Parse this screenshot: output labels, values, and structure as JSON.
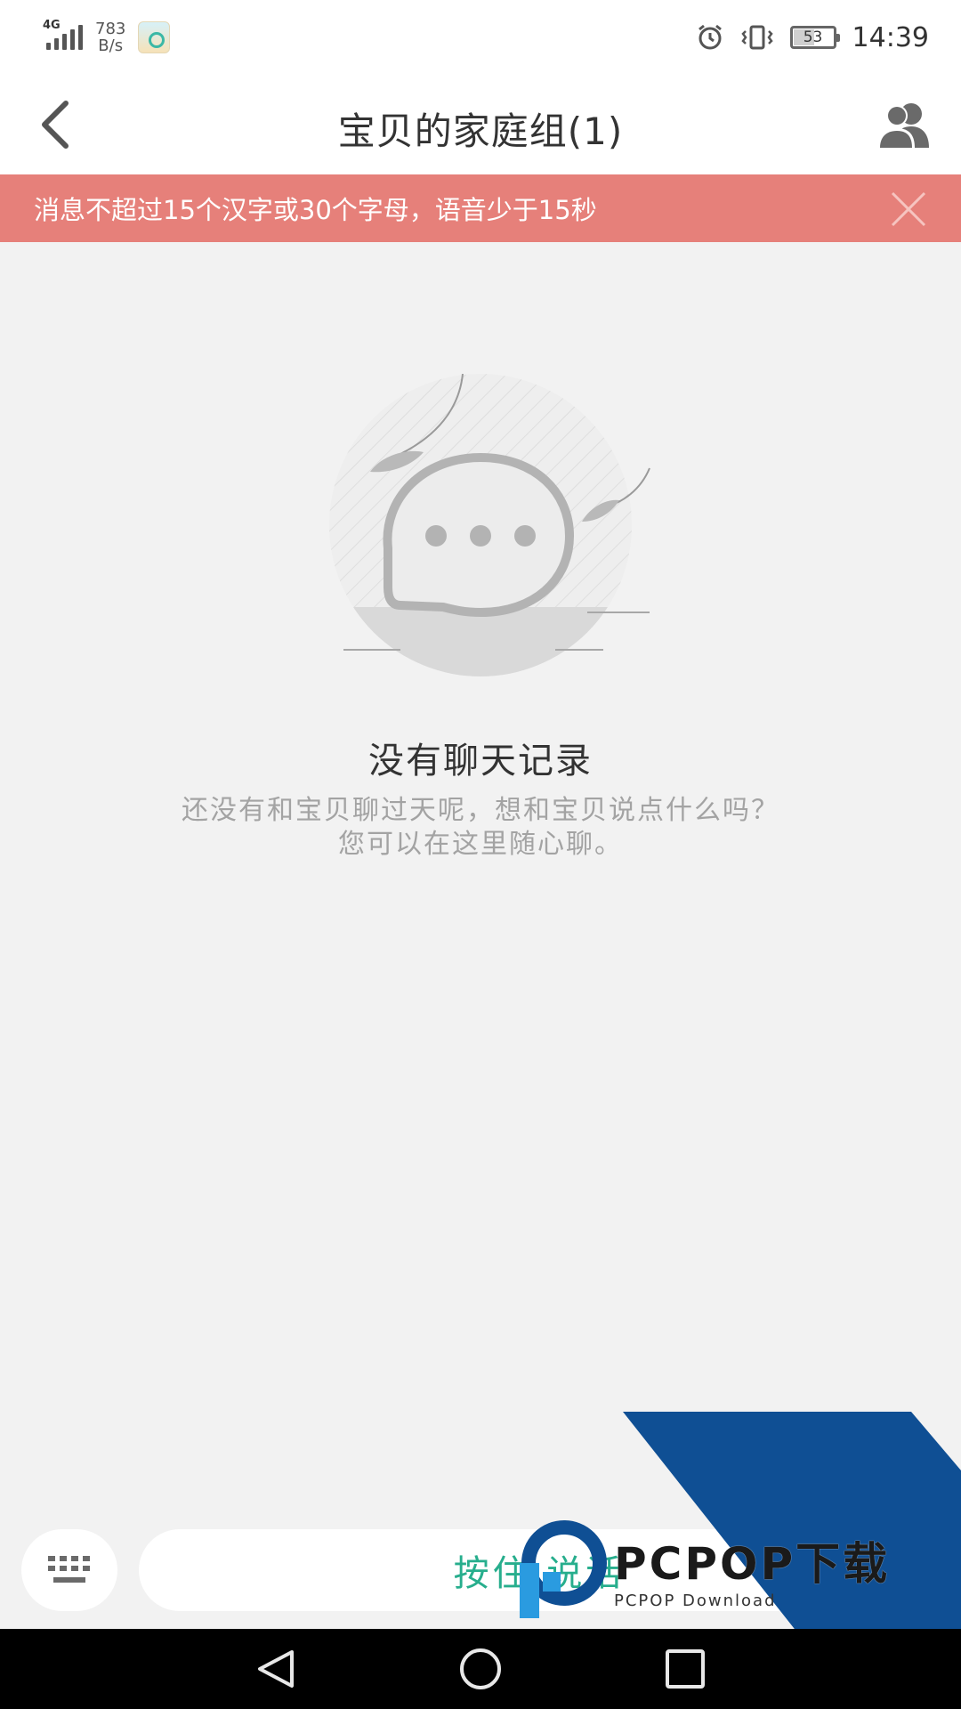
{
  "status_bar": {
    "network_type": "4G",
    "net_speed_value": "783",
    "net_speed_unit": "B/s",
    "time": "14:39",
    "battery_level": "53",
    "alarm_icon": "alarm-icon",
    "vibrate_icon": "vibrate-icon"
  },
  "header": {
    "title": "宝贝的家庭组(1)",
    "back_icon": "chevron-left-icon",
    "members_icon": "group-members-icon"
  },
  "notice": {
    "text": "消息不超过15个汉字或30个字母，语音少于15秒",
    "close_icon": "close-icon"
  },
  "empty_state": {
    "title": "没有聊天记录",
    "line1": "还没有和宝贝聊过天呢，想和宝贝说点什么吗？",
    "line2": "您可以在这里随心聊。"
  },
  "input_bar": {
    "keyboard_icon": "keyboard-icon",
    "hold_to_talk_label": "按住 说话"
  },
  "watermark": {
    "brand": "PCPOP下载",
    "sub": "PCPOP Download",
    "brand_color": "#0f4f94"
  },
  "colors": {
    "notice_bg": "#e6807a",
    "accent_green": "#27ae8d",
    "page_bg": "#f2f2f2"
  }
}
